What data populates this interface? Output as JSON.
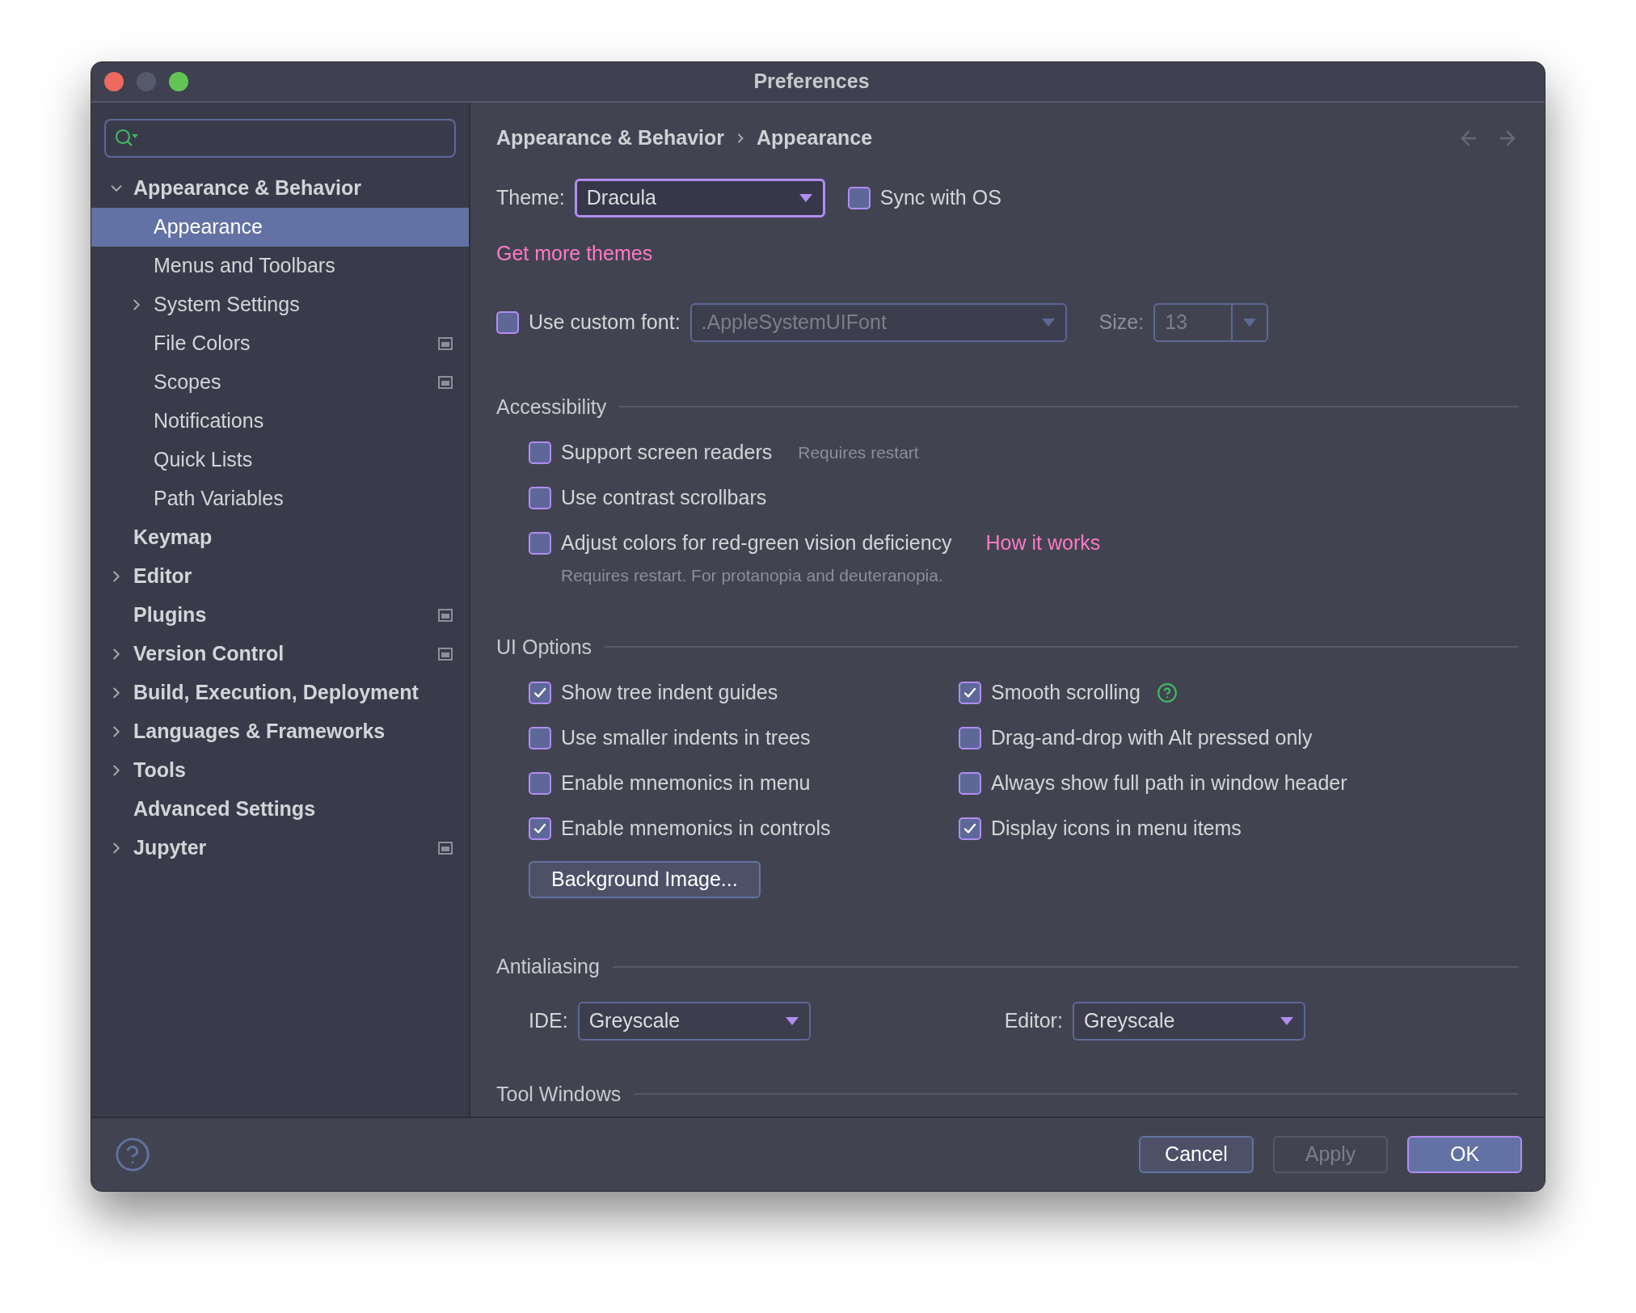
{
  "window": {
    "title": "Preferences"
  },
  "sidebar": {
    "items": [
      {
        "label": "Appearance & Behavior",
        "expanded": true,
        "selected": false,
        "project_icon": false,
        "children": [
          {
            "label": "Appearance",
            "selected": true,
            "project_icon": false
          },
          {
            "label": "Menus and Toolbars",
            "selected": false,
            "project_icon": false
          },
          {
            "label": "System Settings",
            "selected": false,
            "project_icon": false,
            "expanded": false
          },
          {
            "label": "File Colors",
            "selected": false,
            "project_icon": true
          },
          {
            "label": "Scopes",
            "selected": false,
            "project_icon": true
          },
          {
            "label": "Notifications",
            "selected": false,
            "project_icon": false
          },
          {
            "label": "Quick Lists",
            "selected": false,
            "project_icon": false
          },
          {
            "label": "Path Variables",
            "selected": false,
            "project_icon": false
          }
        ]
      },
      {
        "label": "Keymap",
        "selected": false,
        "project_icon": false
      },
      {
        "label": "Editor",
        "expanded": false,
        "selected": false,
        "project_icon": false
      },
      {
        "label": "Plugins",
        "selected": false,
        "project_icon": true
      },
      {
        "label": "Version Control",
        "expanded": false,
        "selected": false,
        "project_icon": true
      },
      {
        "label": "Build, Execution, Deployment",
        "expanded": false,
        "selected": false,
        "project_icon": false
      },
      {
        "label": "Languages & Frameworks",
        "expanded": false,
        "selected": false,
        "project_icon": false
      },
      {
        "label": "Tools",
        "expanded": false,
        "selected": false,
        "project_icon": false
      },
      {
        "label": "Advanced Settings",
        "selected": false,
        "project_icon": false
      },
      {
        "label": "Jupyter",
        "expanded": false,
        "selected": false,
        "project_icon": true
      }
    ]
  },
  "breadcrumb": [
    "Appearance & Behavior",
    "Appearance"
  ],
  "theme": {
    "label": "Theme:",
    "value": "Dracula",
    "sync": {
      "label": "Sync with OS",
      "checked": false
    }
  },
  "more_themes_link": "Get more themes",
  "custom_font": {
    "label": "Use custom font:",
    "checked": false,
    "value": ".AppleSystemUIFont",
    "size_label": "Size:",
    "size": "13"
  },
  "accessibility": {
    "title": "Accessibility",
    "options": [
      {
        "label": "Support screen readers",
        "checked": false,
        "note": "Requires restart"
      },
      {
        "label": "Use contrast scrollbars",
        "checked": false
      },
      {
        "label": "Adjust colors for red-green vision deficiency",
        "checked": false,
        "link": "How it works",
        "hint": "Requires restart. For protanopia and deuteranopia."
      }
    ]
  },
  "ui_options": {
    "title": "UI Options",
    "columns": [
      [
        {
          "label": "Show tree indent guides",
          "checked": true
        },
        {
          "label": "Use smaller indents in trees",
          "checked": false
        },
        {
          "label": "Enable mnemonics in menu",
          "checked": false
        },
        {
          "label": "Enable mnemonics in controls",
          "checked": true
        }
      ],
      [
        {
          "label": "Smooth scrolling",
          "checked": true,
          "help": true
        },
        {
          "label": "Drag-and-drop with Alt pressed only",
          "checked": false
        },
        {
          "label": "Always show full path in window header",
          "checked": false
        },
        {
          "label": "Display icons in menu items",
          "checked": true
        }
      ]
    ],
    "button": "Background Image..."
  },
  "antialiasing": {
    "title": "Antialiasing",
    "ide": {
      "label": "IDE:",
      "value": "Greyscale"
    },
    "editor": {
      "label": "Editor:",
      "value": "Greyscale"
    }
  },
  "tool_windows": {
    "title": "Tool Windows"
  },
  "footer": {
    "buttons": [
      {
        "label": "Cancel",
        "kind": "normal"
      },
      {
        "label": "Apply",
        "kind": "disabled"
      },
      {
        "label": "OK",
        "kind": "primary"
      }
    ]
  }
}
